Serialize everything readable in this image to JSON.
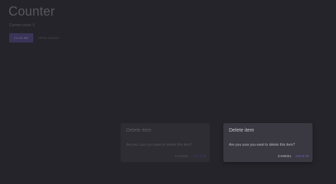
{
  "app": {
    "title": "Counter",
    "count_label": "Current count: 0"
  },
  "buttons": {
    "click_me": "CLICK ME",
    "open_dialog": "OPEN DIALOG"
  },
  "dialog_faded": {
    "title": "Delete item",
    "message": "Are you sure you want to delete this item?",
    "cancel": "CANCEL",
    "delete": "DELETE"
  },
  "dialog_active": {
    "title": "Delete item",
    "message": "Are you sure you want to delete this item?",
    "cancel": "CANCEL",
    "delete": "DELETE"
  },
  "colors": {
    "background": "#25242a",
    "primary_button": "#3a3458",
    "dialog_active_bg": "#3a3941",
    "delete_accent": "#6a60c9"
  }
}
